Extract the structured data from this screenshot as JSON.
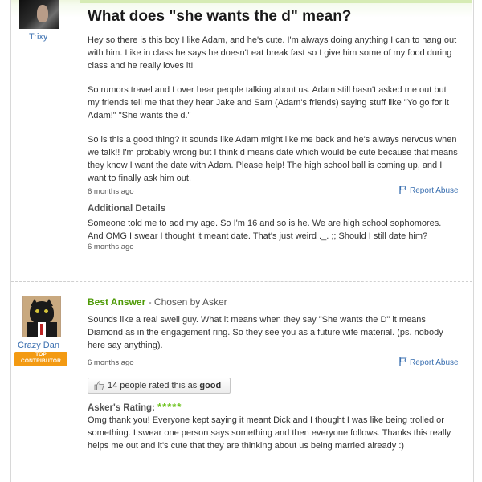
{
  "question": {
    "username": "Trixy",
    "title": "What does \"she wants the d\" mean?",
    "paragraphs": [
      "Hey so there is this boy I like Adam, and he's cute. I'm always doing anything I can to hang out with him. Like in class he says he doesn't eat break fast so I give him some of my food during class and he really loves it!",
      "So rumors travel and I over hear people talking about us. Adam still hasn't asked me out but my friends tell me that they hear Jake and Sam (Adam's friends) saying stuff like \"Yo go for it Adam!\" \"She wants the d.\"",
      "So is this a good thing? It sounds like Adam might like me back and he's always nervous when we talk!! I'm probably wrong but I think d means date which would be cute because that means they know I want the date with Adam. Please help! The high school ball is coming up, and I want to finally ask him out."
    ],
    "timestamp": "6 months ago",
    "report_label": "Report Abuse",
    "additional": {
      "heading": "Additional Details",
      "text": "Someone told me to add my age. So I'm 16 and so is he. We are high school sophomores. And OMG I swear I thought it meant date. That's just weird ._. ;; Should I still date him?",
      "timestamp": "6 months ago"
    }
  },
  "answer": {
    "username": "Crazy Dan",
    "badge_line1": "TOP",
    "badge_line2": "CONTRIBUTOR",
    "best_label": "Best Answer",
    "chosen_by": " - Chosen by Asker",
    "text": "Sounds like a real swell guy. What it means when they say \"She wants the D\" it means Diamond as in the engagement ring. So they see you as a future wife material. (ps. nobody here say anything).",
    "timestamp": "6 months ago",
    "report_label": "Report Abuse",
    "rating_prefix": "14 people rated this as ",
    "rating_word": "good",
    "asker_rating_label": "Asker's Rating: ",
    "asker_stars": "*****",
    "asker_rating_value": 5,
    "asker_comment": "Omg thank you! Everyone kept saying it meant Dick and I thought I was like being trolled or something. I swear one person says something and then everyone follows. Thanks this really helps me out and it's cute that they are thinking about us being married already :)"
  },
  "colors": {
    "link": "#3a6fb0",
    "best_answer": "#4e9a06",
    "stars": "#6bc21b",
    "badge": "#f39a12",
    "header_tint": "#eef6df"
  },
  "icons": {
    "report": "flag-icon",
    "rating": "thumbs-up-icon"
  }
}
